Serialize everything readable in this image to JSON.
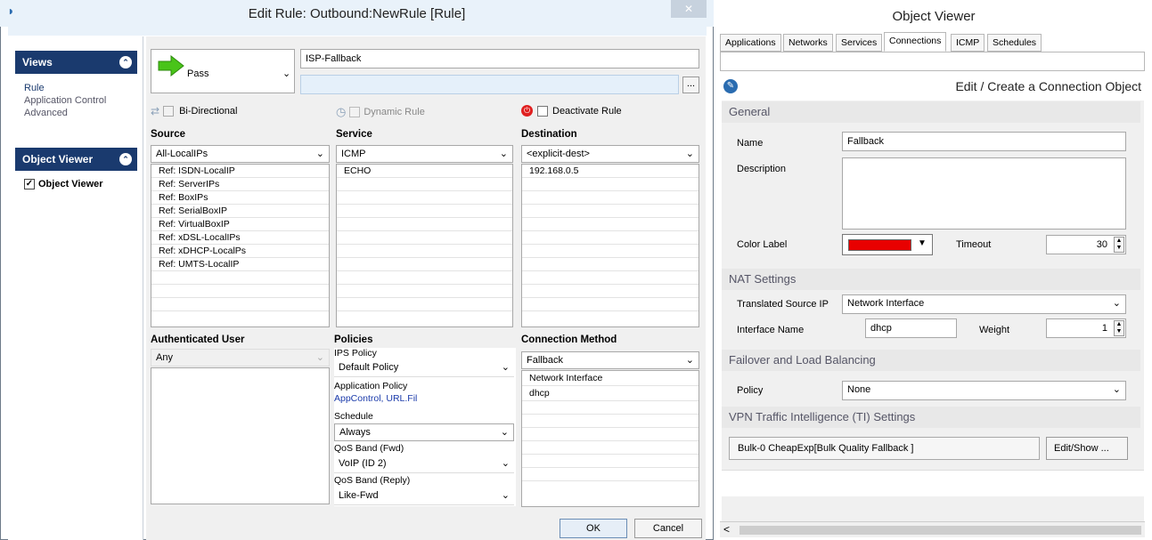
{
  "window": {
    "title": "Edit Rule: Outbound:NewRule [Rule]",
    "close": "✕"
  },
  "views": {
    "title": "Views",
    "items": [
      "Rule",
      "Application Control",
      "Advanced"
    ]
  },
  "object_viewer_panel": {
    "title": "Object Viewer",
    "checkbox_label": "Object Viewer"
  },
  "action": {
    "label": "Pass"
  },
  "rule": {
    "name": "ISP-Fallback",
    "description": "",
    "more": "..."
  },
  "options": {
    "bidirectional": "Bi-Directional",
    "dynamic": "Dynamic Rule",
    "deactivate": "Deactivate Rule"
  },
  "source": {
    "header": "Source",
    "selected": "All-LocalIPs",
    "items": [
      "Ref: ISDN-LocalIP",
      "Ref: ServerIPs",
      "Ref: BoxIPs",
      "Ref: SerialBoxIP",
      "Ref: VirtualBoxIP",
      "Ref: xDSL-LocalIPs",
      "Ref: xDHCP-LocalPs",
      "Ref: UMTS-LocalIP"
    ]
  },
  "service": {
    "header": "Service",
    "selected": "ICMP",
    "items": [
      "ECHO"
    ]
  },
  "destination": {
    "header": "Destination",
    "selected": "<explicit-dest>",
    "items": [
      "192.168.0.5"
    ]
  },
  "auth": {
    "header": "Authenticated User",
    "selected": "Any"
  },
  "policies": {
    "header": "Policies",
    "ips_label": "IPS Policy",
    "ips_value": "Default Policy",
    "app_label": "Application Policy",
    "app_value": "AppControl, URL.Fil",
    "schedule_label": "Schedule",
    "schedule_value": "Always",
    "qos_fwd_label": "QoS Band (Fwd)",
    "qos_fwd_value": "VoIP (ID 2)",
    "qos_reply_label": "QoS Band (Reply)",
    "qos_reply_value": "Like-Fwd"
  },
  "connection": {
    "header": "Connection Method",
    "selected": "Fallback",
    "items": [
      "Network Interface",
      "dhcp"
    ]
  },
  "buttons": {
    "ok": "OK",
    "cancel": "Cancel"
  },
  "ov": {
    "title": "Object Viewer",
    "tabs": [
      "Applications",
      "Networks",
      "Services",
      "Connections",
      "ICMP",
      "Schedules"
    ],
    "edit_title": "Edit / Create a Connection Object"
  },
  "form": {
    "general": "General",
    "name_label": "Name",
    "name_value": "Fallback",
    "desc_label": "Description",
    "color_label": "Color Label",
    "color": "#e80000",
    "timeout_label": "Timeout",
    "timeout_value": "30",
    "nat": "NAT Settings",
    "tsip_label": "Translated Source IP",
    "tsip_value": "Network Interface",
    "ifname_label": "Interface Name",
    "ifname_value": "dhcp",
    "weight_label": "Weight",
    "weight_value": "1",
    "failover": "Failover and Load Balancing",
    "policy_label": "Policy",
    "policy_value": "None",
    "vpn": "VPN Traffic Intelligence (TI) Settings",
    "vpn_value": "Bulk-0 CheapExp[Bulk Quality Fallback ]",
    "editshow": "Edit/Show ..."
  },
  "scroll": {
    "left": "<"
  }
}
